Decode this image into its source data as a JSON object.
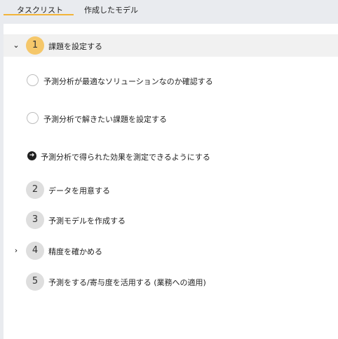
{
  "tabs": [
    {
      "label": "タスクリスト",
      "active": true
    },
    {
      "label": "作成したモデル",
      "active": false
    }
  ],
  "colors": {
    "accent": "#f2b43a",
    "active_step_circle": "#f5c76a",
    "inactive_step_circle": "#dedede",
    "active_row_bg": "#f1f1f1"
  },
  "steps": [
    {
      "number": "1",
      "label": "課題を設定する",
      "expanded": true,
      "chevron_icon": "chevron-down-icon",
      "subtasks": [
        {
          "label": "予測分析が最適なソリューションなのか確認する",
          "icon": "empty-circle-icon"
        },
        {
          "label": "予測分析で解きたい課題を設定する",
          "icon": "empty-circle-icon"
        },
        {
          "label": "予測分析で得られた効果を測定できるようにする",
          "icon": "arrow-right-circle-icon"
        }
      ]
    },
    {
      "number": "2",
      "label": "データを用意する"
    },
    {
      "number": "3",
      "label": "予測モデルを作成する"
    },
    {
      "number": "4",
      "label": "精度を確かめる",
      "chevron_icon": "chevron-right-icon"
    },
    {
      "number": "5",
      "label": "予測をする/寄与度を活用する (業務への適用)"
    }
  ]
}
